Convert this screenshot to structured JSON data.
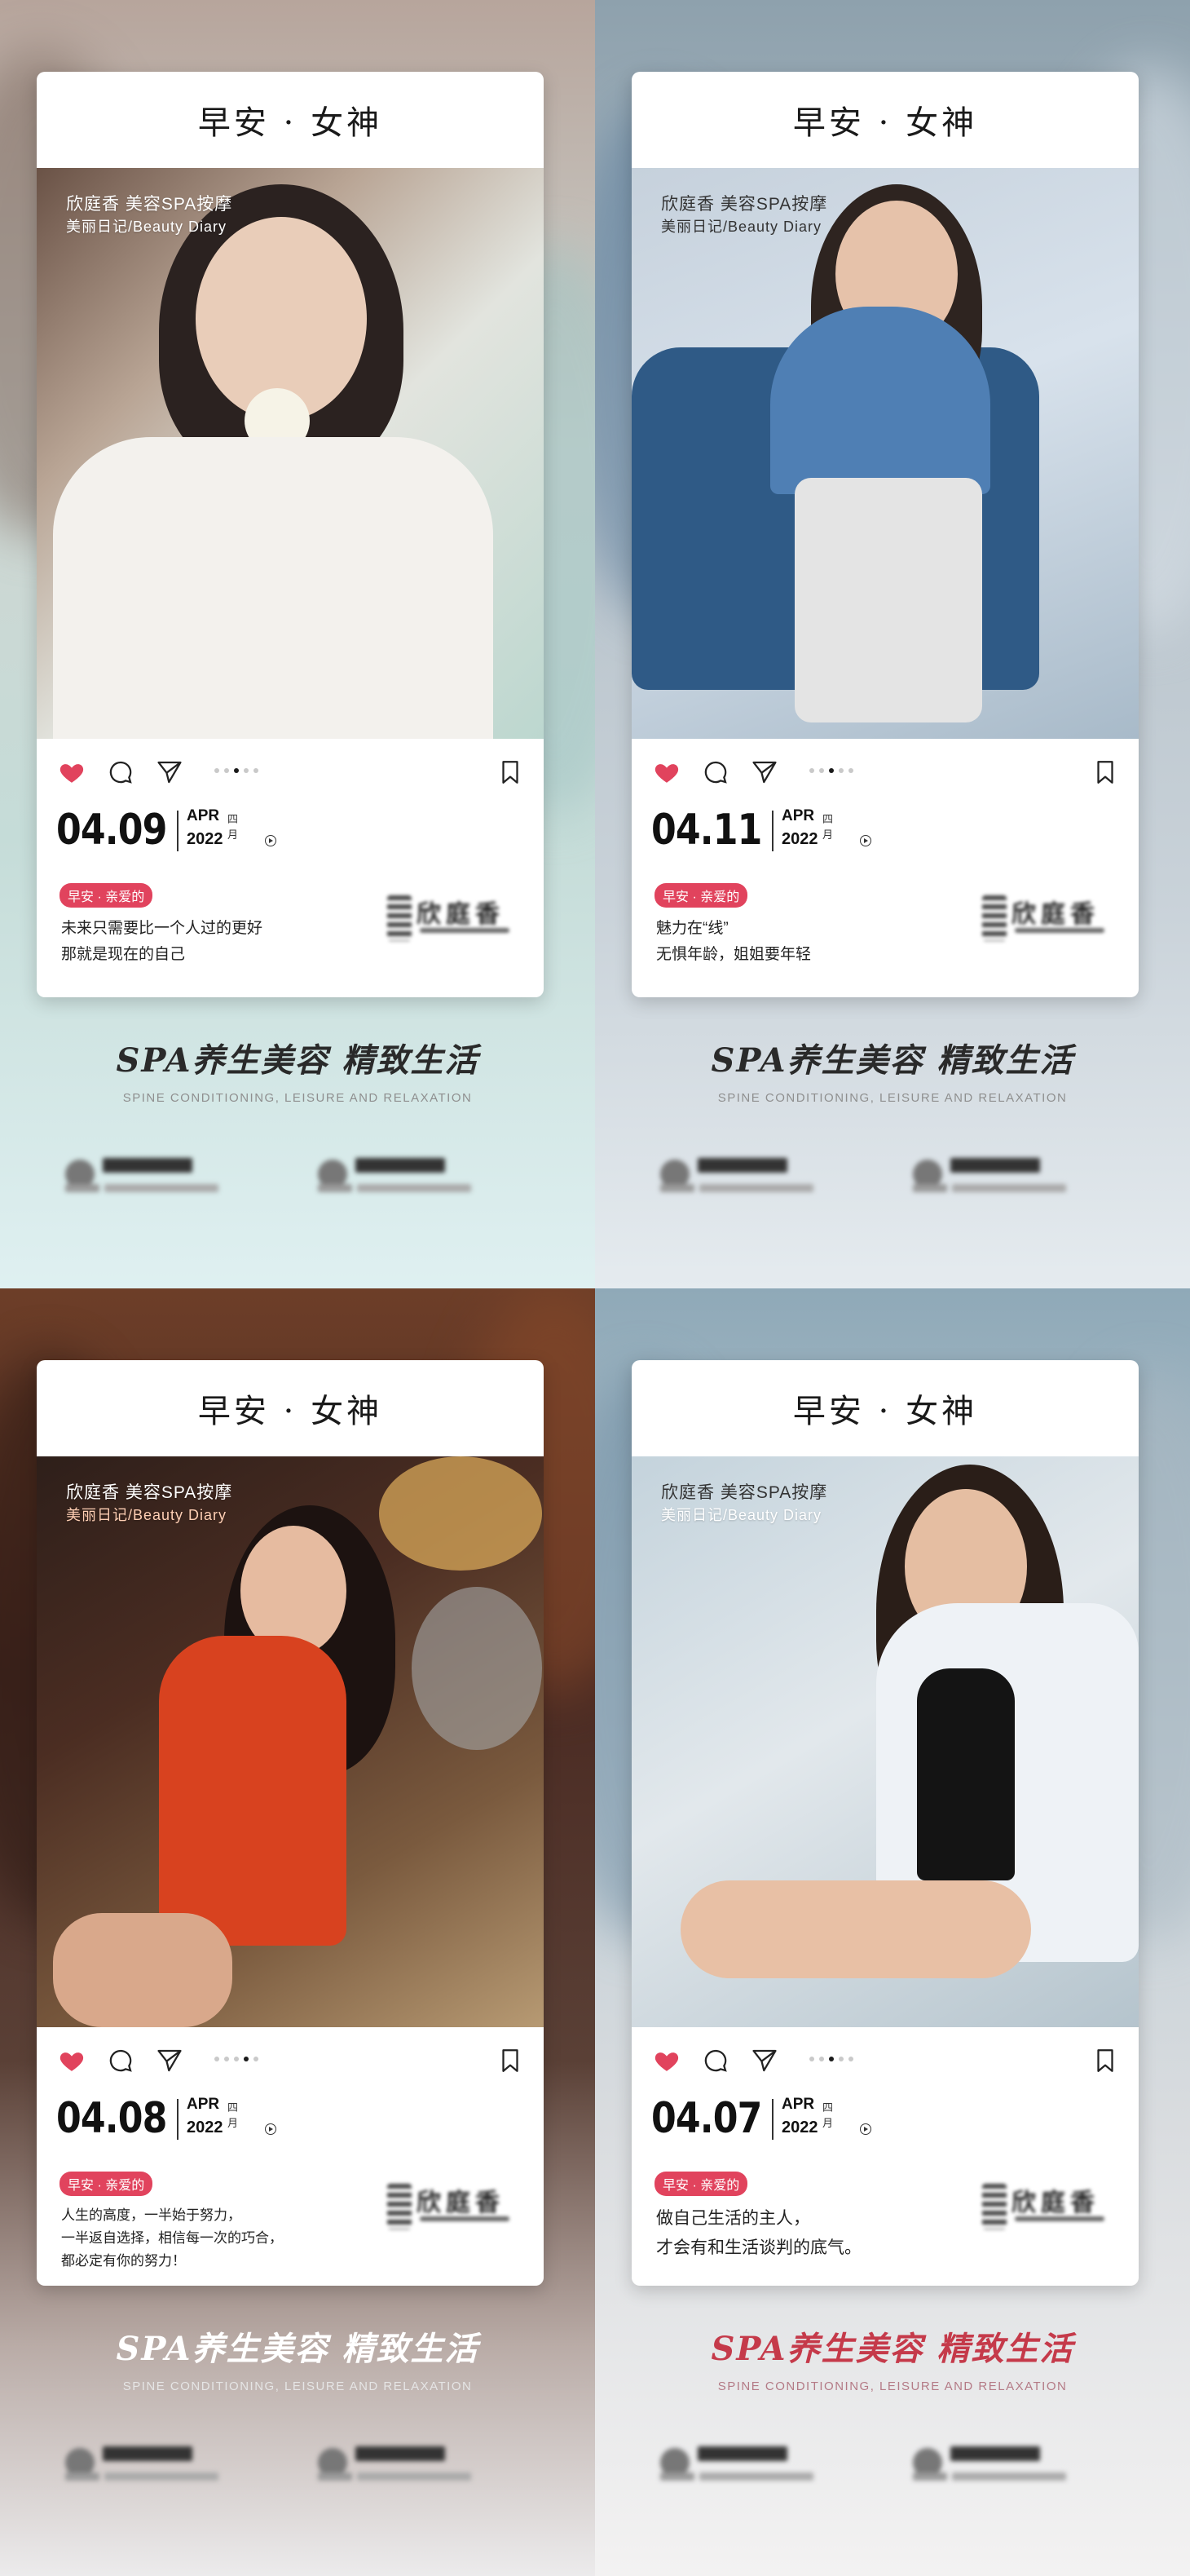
{
  "posters": [
    {
      "header": "早安 · 女神",
      "brand": "欣庭香   美容SPA按摩",
      "diary": "美丽日记/Beauty Diary",
      "date": "04.09",
      "month": "APR",
      "month_cn": "四月",
      "year": "2022",
      "tag": "早安 · 亲爱的",
      "message": [
        "未来只需要比一个人过的更好",
        "那就是现在的自己"
      ],
      "slogan": "SPA养生美容  精致生活",
      "slogan_en": "SPINE CONDITIONING, LEISURE AND RELAXATION",
      "logo_text": "欣庭香"
    },
    {
      "header": "早安 · 女神",
      "brand": "欣庭香   美容SPA按摩",
      "diary": "美丽日记/Beauty Diary",
      "date": "04.11",
      "month": "APR",
      "month_cn": "四月",
      "year": "2022",
      "tag": "早安 · 亲爱的",
      "message": [
        "魅力在“线”",
        "无惧年龄，姐姐要年轻"
      ],
      "slogan": "SPA养生美容  精致生活",
      "slogan_en": "SPINE CONDITIONING, LEISURE AND RELAXATION",
      "logo_text": "欣庭香"
    },
    {
      "header": "早安 · 女神",
      "brand": "欣庭香   美容SPA按摩",
      "diary": "美丽日记/Beauty Diary",
      "date": "04.08",
      "month": "APR",
      "month_cn": "四月",
      "year": "2022",
      "tag": "早安 · 亲爱的",
      "message": [
        "人生的高度，一半始于努力，",
        "一半返自选择，相信每一次的巧合，",
        "都必定有你的努力！"
      ],
      "slogan": "SPA养生美容  精致生活",
      "slogan_en": "SPINE CONDITIONING, LEISURE AND RELAXATION",
      "logo_text": "欣庭香"
    },
    {
      "header": "早安 · 女神",
      "brand": "欣庭香   美容SPA按摩",
      "diary": "美丽日记/Beauty Diary",
      "date": "04.07",
      "month": "APR",
      "month_cn": "四月",
      "year": "2022",
      "tag": "早安 · 亲爱的",
      "message": [
        "做自己生活的主人，",
        "才会有和生活谈判的底气。"
      ],
      "slogan": "SPA养生美容  精致生活",
      "slogan_en": "SPINE CONDITIONING, LEISURE AND RELAXATION",
      "logo_text": "欣庭香"
    }
  ],
  "icons": {
    "like": "heart-icon",
    "comment": "comment-icon",
    "share": "send-icon",
    "save": "bookmark-icon",
    "play": "play-icon"
  },
  "colors": {
    "heart": "#e1435d",
    "tag": "#e1435d",
    "slogan_red": "#c53a4a"
  }
}
